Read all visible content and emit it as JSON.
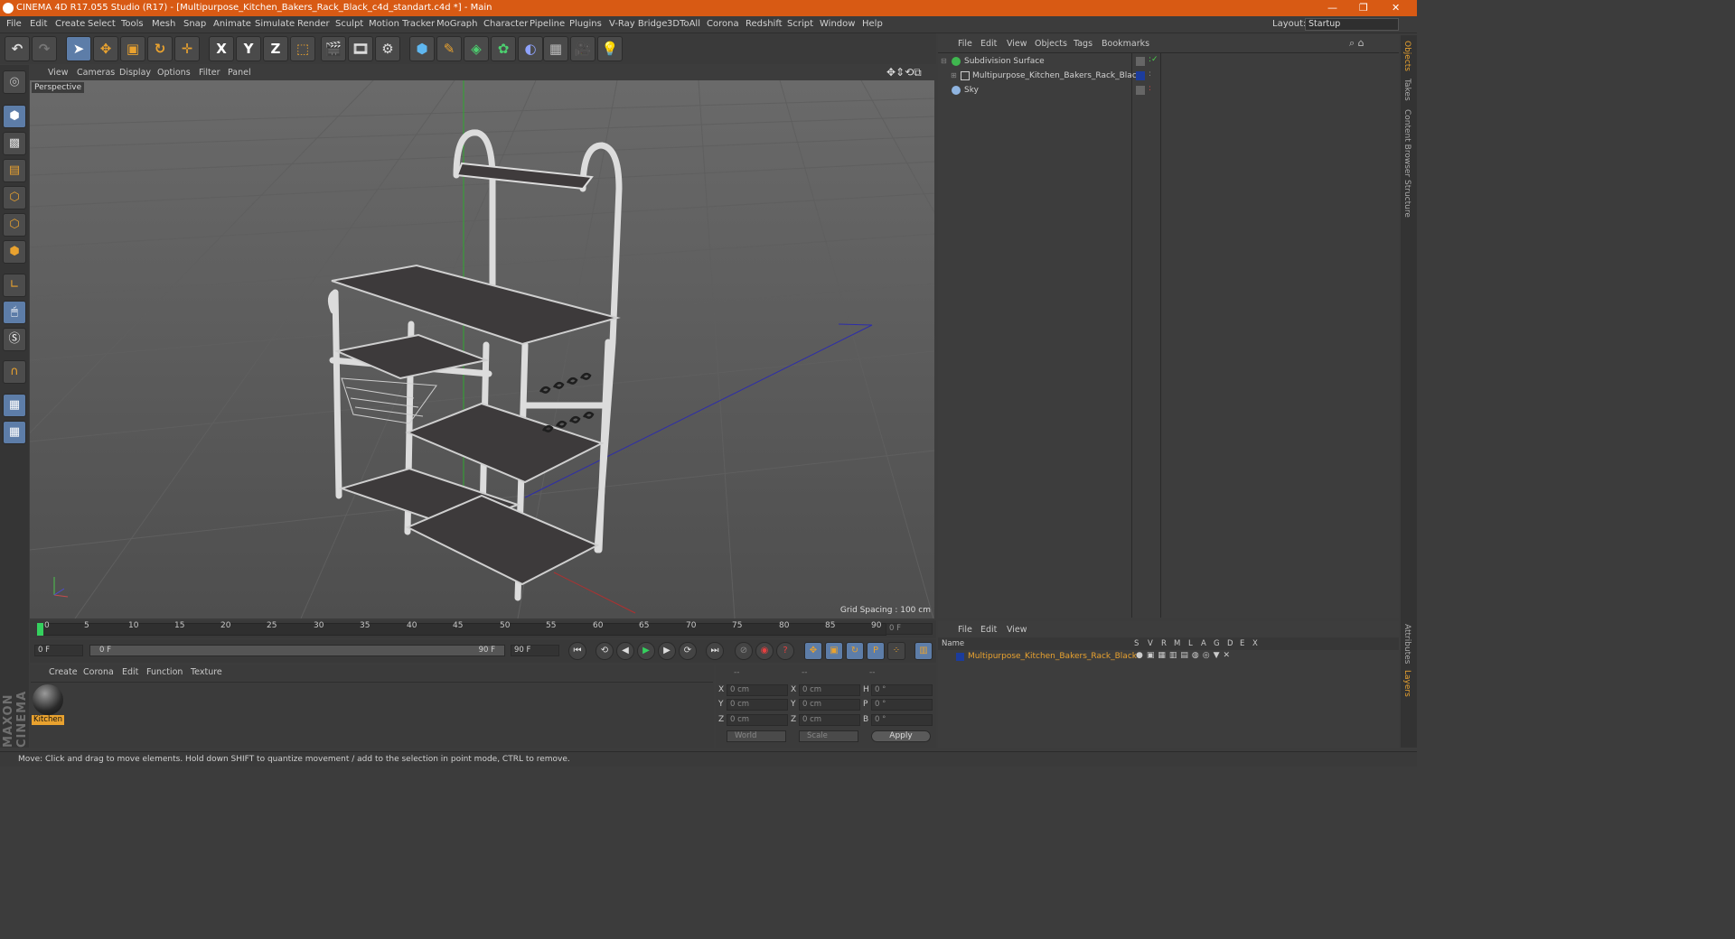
{
  "window": {
    "title": "CINEMA 4D R17.055 Studio (R17) - [Multipurpose_Kitchen_Bakers_Rack_Black_c4d_standart.c4d *] - Main",
    "layout_label": "Layout:",
    "layout_value": "Startup"
  },
  "menu": [
    "File",
    "Edit",
    "Create",
    "Select",
    "Tools",
    "Mesh",
    "Snap",
    "Animate",
    "Simulate",
    "Render",
    "Sculpt",
    "Motion Tracker",
    "MoGraph",
    "Character",
    "Pipeline",
    "Plugins",
    "V-Ray Bridge",
    "3DToAll",
    "Corona",
    "Redshift",
    "Script",
    "Window",
    "Help"
  ],
  "toolbar": {
    "x": "X",
    "y": "Y",
    "z": "Z"
  },
  "viewport": {
    "menu": [
      "View",
      "Cameras",
      "Display",
      "Options",
      "Filter",
      "Panel"
    ],
    "label": "Perspective",
    "grid_spacing": "Grid Spacing : 100 cm"
  },
  "timeline": {
    "ticks": [
      "0",
      "5",
      "10",
      "15",
      "20",
      "25",
      "30",
      "35",
      "40",
      "45",
      "50",
      "55",
      "60",
      "65",
      "70",
      "75",
      "80",
      "85",
      "90"
    ],
    "current_frame": "0 F",
    "start_field": "0 F",
    "range_start": "0 F",
    "range_end": "90 F",
    "end_field": "90 F"
  },
  "material_manager": {
    "menu": [
      "Create",
      "Corona",
      "Edit",
      "Function",
      "Texture"
    ],
    "material_name": "Kitchen"
  },
  "coordinates": {
    "headers": [
      "--",
      "--",
      "--"
    ],
    "rows": [
      {
        "axis": "X",
        "pos": "0 cm",
        "axis2": "X",
        "size": "0 cm",
        "rot_label": "H",
        "rot": "0 °"
      },
      {
        "axis": "Y",
        "pos": "0 cm",
        "axis2": "Y",
        "size": "0 cm",
        "rot_label": "P",
        "rot": "0 °"
      },
      {
        "axis": "Z",
        "pos": "0 cm",
        "axis2": "Z",
        "size": "0 cm",
        "rot_label": "B",
        "rot": "0 °"
      }
    ],
    "mode1": "World",
    "mode2": "Scale",
    "apply": "Apply"
  },
  "object_manager": {
    "menu": [
      "File",
      "Edit",
      "View",
      "Objects",
      "Tags",
      "Bookmarks"
    ],
    "objects": [
      "Subdivision Surface",
      "Multipurpose_Kitchen_Bakers_Rack_Black",
      "Sky"
    ]
  },
  "layer_manager": {
    "menu": [
      "File",
      "Edit",
      "View"
    ],
    "col_name": "Name",
    "cols": [
      "S",
      "V",
      "R",
      "M",
      "L",
      "A",
      "G",
      "D",
      "E",
      "X"
    ],
    "layer": "Multipurpose_Kitchen_Bakers_Rack_Black"
  },
  "side_tabs": [
    "Objects",
    "Takes",
    "Content Browser",
    "Structure",
    "Attributes",
    "Layers"
  ],
  "brand": "MAXON CINEMA 4D",
  "status": "Move: Click and drag to move elements. Hold down SHIFT to quantize movement / add to the selection in point mode, CTRL to remove.",
  "colors": {
    "title_bar": "#d85a14",
    "accent_blue": "#5d7da8",
    "selection_orange": "#e9a22f",
    "layer_blue": "#1c3c9c"
  }
}
